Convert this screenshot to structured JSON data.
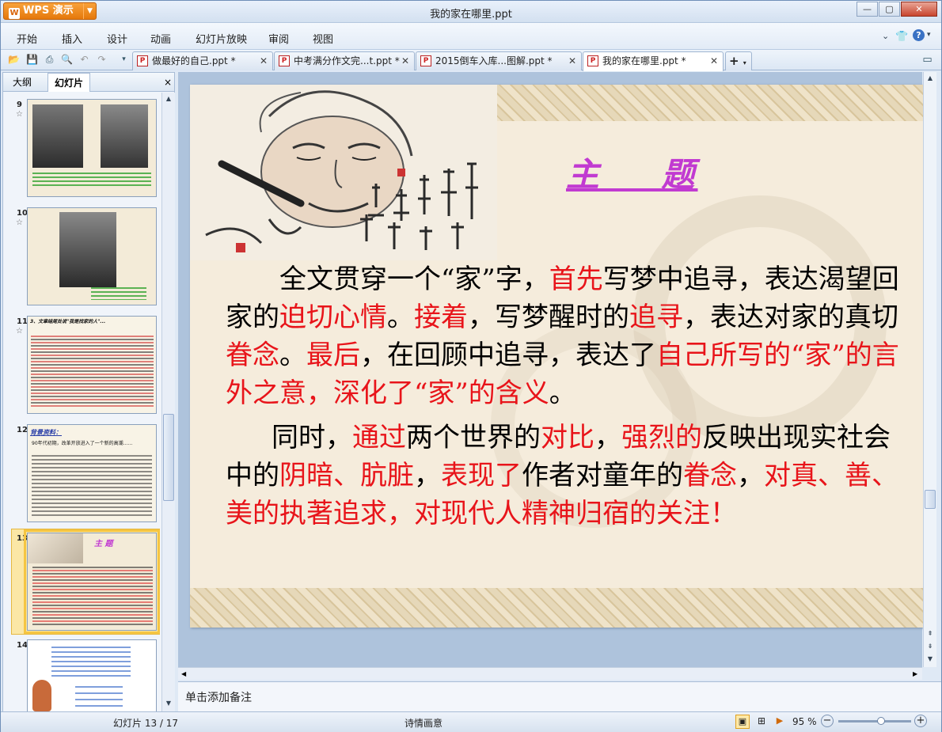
{
  "app": {
    "name": "WPS 演示",
    "window_title": "我的家在哪里.ppt"
  },
  "menu": [
    "开始",
    "插入",
    "设计",
    "动画",
    "幻灯片放映",
    "审阅",
    "视图"
  ],
  "tabs": [
    {
      "label": "做最好的自己.ppt *"
    },
    {
      "label": "中考满分作文完...t.ppt *"
    },
    {
      "label": "2015倒车入库...图解.ppt *"
    },
    {
      "label": "我的家在哪里.ppt *"
    }
  ],
  "left_pane": {
    "tab_outline": "大纲",
    "tab_slides": "幻灯片",
    "close": "×"
  },
  "thumbnails": [
    {
      "num": "9",
      "star": "☆"
    },
    {
      "num": "10",
      "star": "☆"
    },
    {
      "num": "11",
      "star": "☆",
      "text": "3、文章结尾处说\"我是找家的人\"..."
    },
    {
      "num": "12",
      "star": "",
      "heading": "背景资料：",
      "text": "90年代初期，改革开放进入了一个新的高潮……"
    },
    {
      "num": "13",
      "star": "",
      "heading": "主 题"
    },
    {
      "num": "14",
      "star": ""
    }
  ],
  "slide": {
    "title": "主    题",
    "p1": [
      {
        "t": "全文贯穿一个“家”字，",
        "red": false
      },
      {
        "t": "首先",
        "red": true
      },
      {
        "t": "写梦中追寻，表达渴望回家的",
        "red": false
      },
      {
        "t": "迫切心情",
        "red": true
      },
      {
        "t": "。",
        "red": false
      },
      {
        "t": "接着",
        "red": true
      },
      {
        "t": "，写梦醒时的",
        "red": false
      },
      {
        "t": "追寻",
        "red": true
      },
      {
        "t": "，表达对家的真切",
        "red": false
      },
      {
        "t": "眷念",
        "red": true
      },
      {
        "t": "。",
        "red": false
      },
      {
        "t": "最后",
        "red": true
      },
      {
        "t": "，在回顾中追寻，表达了",
        "red": false
      },
      {
        "t": "自己所写的“家”的言外之意，深化了“家”的含义",
        "red": true
      },
      {
        "t": "。",
        "red": false
      }
    ],
    "p2": [
      {
        "t": "同时，",
        "red": false
      },
      {
        "t": "通过",
        "red": true
      },
      {
        "t": "两个世界的",
        "red": false
      },
      {
        "t": "对比",
        "red": true
      },
      {
        "t": "，",
        "red": false
      },
      {
        "t": "强烈的",
        "red": true
      },
      {
        "t": "反映出现实社会中的",
        "red": false
      },
      {
        "t": "阴暗、肮脏",
        "red": true
      },
      {
        "t": "，",
        "red": false
      },
      {
        "t": "表现了",
        "red": true
      },
      {
        "t": "作者对童年的",
        "red": false
      },
      {
        "t": "眷念",
        "red": true
      },
      {
        "t": "，",
        "red": false
      },
      {
        "t": "对真、善、美的执著追求，对现代人精神归宿的关注！",
        "red": true
      }
    ]
  },
  "notes_placeholder": "单击添加备注",
  "status": {
    "slide_count": "幻灯片 13 / 17",
    "theme": "诗情画意",
    "zoom": "95 %",
    "zoom_level": 0.6
  },
  "colors": {
    "accent_red": "#e8141a",
    "title_purple": "#c13ad1",
    "wps_orange": "#e5780b"
  }
}
